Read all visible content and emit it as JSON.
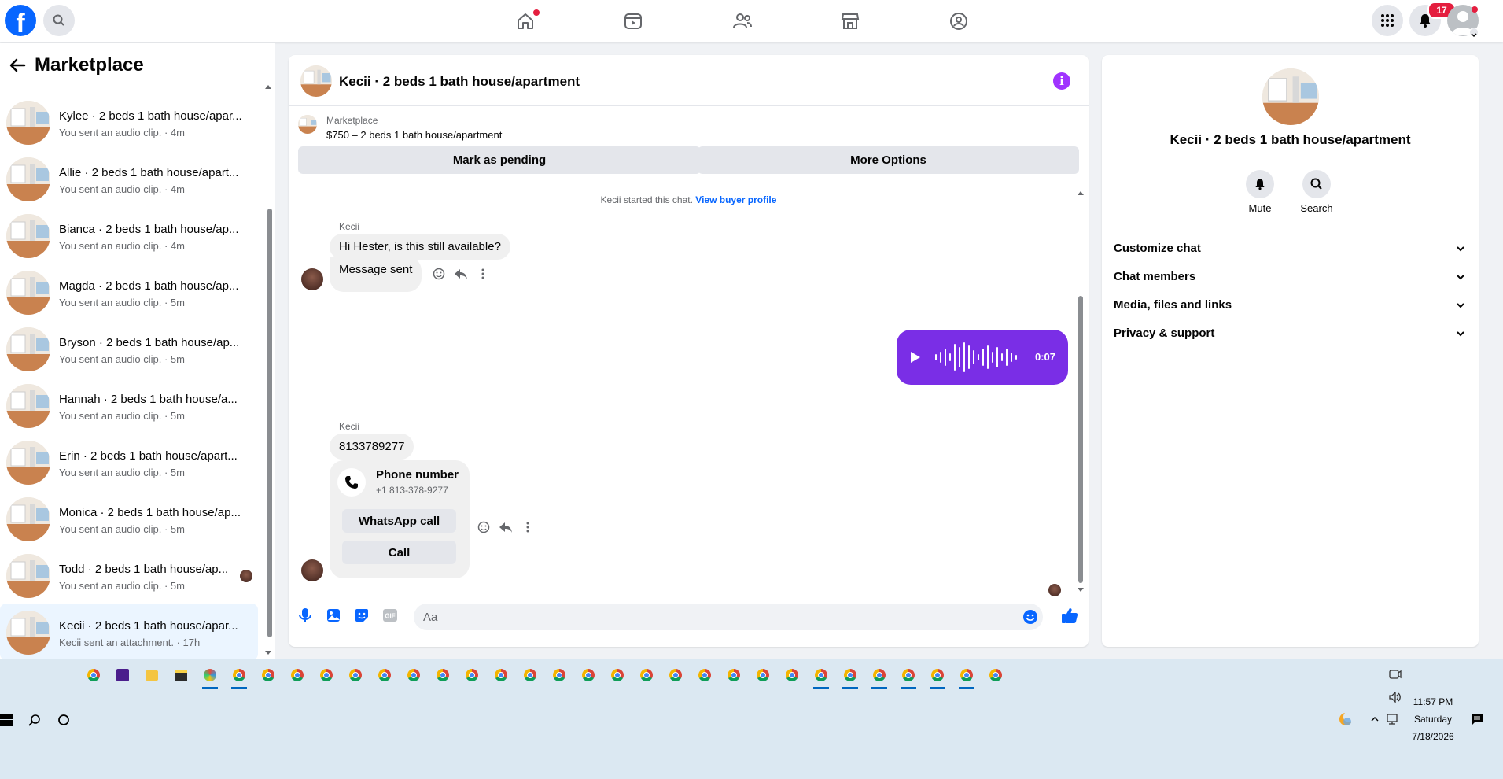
{
  "topbar": {
    "logo": "f",
    "notifications_badge": "17",
    "nav_icons": [
      "home-icon",
      "video-icon",
      "friends-icon",
      "marketplace-icon",
      "groups-icon"
    ]
  },
  "sidebar": {
    "title": "Marketplace",
    "conversations": [
      {
        "name": "Kylee · 2 beds 1 bath house/apar...",
        "sub": "You sent an audio clip. · 4m"
      },
      {
        "name": "Allie · 2 beds 1 bath house/apart...",
        "sub": "You sent an audio clip. · 4m"
      },
      {
        "name": "Bianca · 2 beds 1 bath house/ap...",
        "sub": "You sent an audio clip. · 4m"
      },
      {
        "name": "Magda · 2 beds 1 bath house/ap...",
        "sub": "You sent an audio clip. · 5m"
      },
      {
        "name": "Bryson · 2 beds 1 bath house/ap...",
        "sub": "You sent an audio clip. · 5m"
      },
      {
        "name": "Hannah · 2 beds 1 bath house/a...",
        "sub": "You sent an audio clip. · 5m"
      },
      {
        "name": "Erin · 2 beds 1 bath house/apart...",
        "sub": "You sent an audio clip. · 5m"
      },
      {
        "name": "Monica · 2 beds 1 bath house/ap...",
        "sub": "You sent an audio clip. · 5m"
      },
      {
        "name": "Todd · 2 beds 1 bath house/ap...",
        "sub": "You sent an audio clip. · 5m"
      },
      {
        "name": "Kecii · 2 beds 1 bath house/apar...",
        "sub": "Kecii sent an attachment. · 17h"
      }
    ]
  },
  "chat": {
    "title": "Kecii · 2 beds 1 bath house/apartment",
    "marketplace_label": "Marketplace",
    "listing": "$750 – 2 beds 1 bath house/apartment",
    "mark_pending": "Mark as pending",
    "more_options": "More Options",
    "system_text": "Kecii started this chat.",
    "view_buyer": "View buyer profile",
    "sender": "Kecii",
    "msg1": "Hi Hester, is this still available?",
    "msg2": "Message sent",
    "audio_duration": "0:07",
    "sender2": "Kecii",
    "msg3": "8133789277",
    "contact_title": "Phone number",
    "contact_number": "+1 813-378-9277",
    "whatsapp": "WhatsApp call",
    "call": "Call",
    "composer_placeholder": "Aa"
  },
  "rpanel": {
    "title": "Kecii · 2 beds 1 bath house/apartment",
    "mute": "Mute",
    "search": "Search",
    "rows": [
      "Customize chat",
      "Chat members",
      "Media, files and links",
      "Privacy & support"
    ]
  },
  "taskbar": {
    "time": "11:57 PM",
    "day": "Saturday",
    "date": "7/18/2026"
  },
  "colors": {
    "accent": "#0866ff",
    "audio_bubble": "#7a2ee6",
    "badge": "#e41e3f"
  }
}
